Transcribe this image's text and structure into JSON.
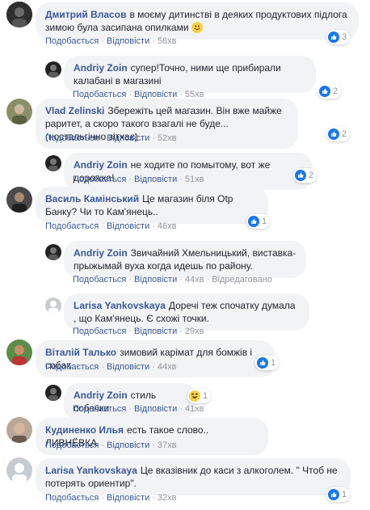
{
  "labels": {
    "like": "Подобається",
    "reply": "Відповісти",
    "edited": "Відредаговано"
  },
  "comments": [
    {
      "author": "Дмитрий Власов",
      "text": "в моєму дитинстві в деяких продуктових підлога зимою була засипана опилками",
      "time": "56хв",
      "reactions": "3"
    },
    {
      "author": "Andriy Zoin",
      "text": "супер!Точно, ними ще прибирали калабані в магазині",
      "time": "55хв",
      "reactions": "2"
    },
    {
      "author": "Vlad Zelinski",
      "text": "Збережіть цей магазин. Він вже майже раритет, а скоро такого взагалі не буде... (ностальгічно зітхає)",
      "time": "52хв",
      "reactions": "2"
    },
    {
      "author": "Andriy Zoin",
      "text": "не ходите по помытому, вот же дорожка!",
      "time": "51хв",
      "reactions": "2"
    },
    {
      "author": "Василь Камінський",
      "text": "Це магазин біля Otp Банку? Чи то Кам'янець..",
      "time": "46хв",
      "reactions": "1"
    },
    {
      "author": "Andriy Zoin",
      "text": "Звичайний Хмельницький, виставка- прыжымай вуха когда идешь по району.",
      "time": "44хв",
      "reactions": ""
    },
    {
      "author": "Larisa Yankovskaya",
      "text": "Доречі теж спочатку думала , що Кам'янець. Є схожі точки.",
      "time": "29хв",
      "reactions": ""
    },
    {
      "author": "Віталій Талько",
      "text": "зимовий карімат для бомжів і собак",
      "time": "44хв",
      "reactions": "1"
    },
    {
      "author": "Andriy Zoin",
      "text": "стиль собачки",
      "time": "41хв",
      "reactions": "1"
    },
    {
      "author": "Кудиненко Илья",
      "text": "есть такое слово.. ЛИВНЁВКА",
      "time": "37хв",
      "reactions": ""
    },
    {
      "author": "Larisa Yankovskaya",
      "text": "Це вказівник до каси з алкоголем. \" Чтоб не потерять ориентир\".",
      "time": "32хв",
      "reactions": "1"
    }
  ],
  "colors": {
    "link": "#385898",
    "bubble": "#f2f3f5",
    "meta": "#90949c",
    "like": "#1877f2"
  }
}
